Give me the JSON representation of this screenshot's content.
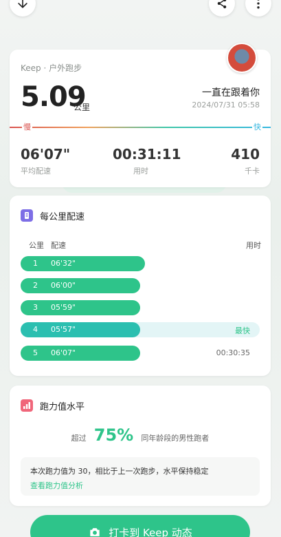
{
  "colors": {
    "accent": "#2ec48a",
    "slow": "#d9534f",
    "fast": "#36b7e0",
    "highlight_row": "#e3f5f6",
    "fastest_bar": "#2bbfb0"
  },
  "topbar": {
    "download_icon": "arrow-down-icon",
    "share_icon": "share-icon",
    "more_icon": "more-vertical-icon"
  },
  "summary": {
    "activity_label": "Keep · 户外跑步",
    "distance": "5.09",
    "distance_unit": "公里",
    "title": "一直在跟着你",
    "datetime": "2024/07/31 05:58",
    "slow_label": "慢",
    "fast_label": "快",
    "stats": [
      {
        "value": "06'07\"",
        "label": "平均配速"
      },
      {
        "value": "00:31:11",
        "label": "用时"
      },
      {
        "value": "410",
        "label": "千卡"
      }
    ]
  },
  "splits": {
    "title": "每公里配速",
    "headers": {
      "km": "公里",
      "pace": "配速",
      "time": "用时"
    },
    "rows": [
      {
        "km": "1",
        "pace": "06'32\"",
        "bar_fraction": 0.52,
        "note": "",
        "highlight": false
      },
      {
        "km": "2",
        "pace": "06'00\"",
        "bar_fraction": 0.5,
        "note": "",
        "highlight": false
      },
      {
        "km": "3",
        "pace": "05'59\"",
        "bar_fraction": 0.5,
        "note": "",
        "highlight": false
      },
      {
        "km": "4",
        "pace": "05'57\"",
        "bar_fraction": 0.5,
        "note": "最快",
        "highlight": true
      },
      {
        "km": "5",
        "pace": "06'07\"",
        "bar_fraction": 0.5,
        "note": "00:30:35",
        "highlight": false
      }
    ]
  },
  "level": {
    "title": "跑力值水平",
    "prefix": "超过",
    "percent": "75%",
    "suffix": "同年龄段的男性跑者",
    "note": "本次跑力值为 30，相比于上一次跑步，水平保持稳定",
    "link": "查看跑力值分析"
  },
  "cta": {
    "label": "打卡到 Keep 动态",
    "icon": "camera-icon"
  }
}
